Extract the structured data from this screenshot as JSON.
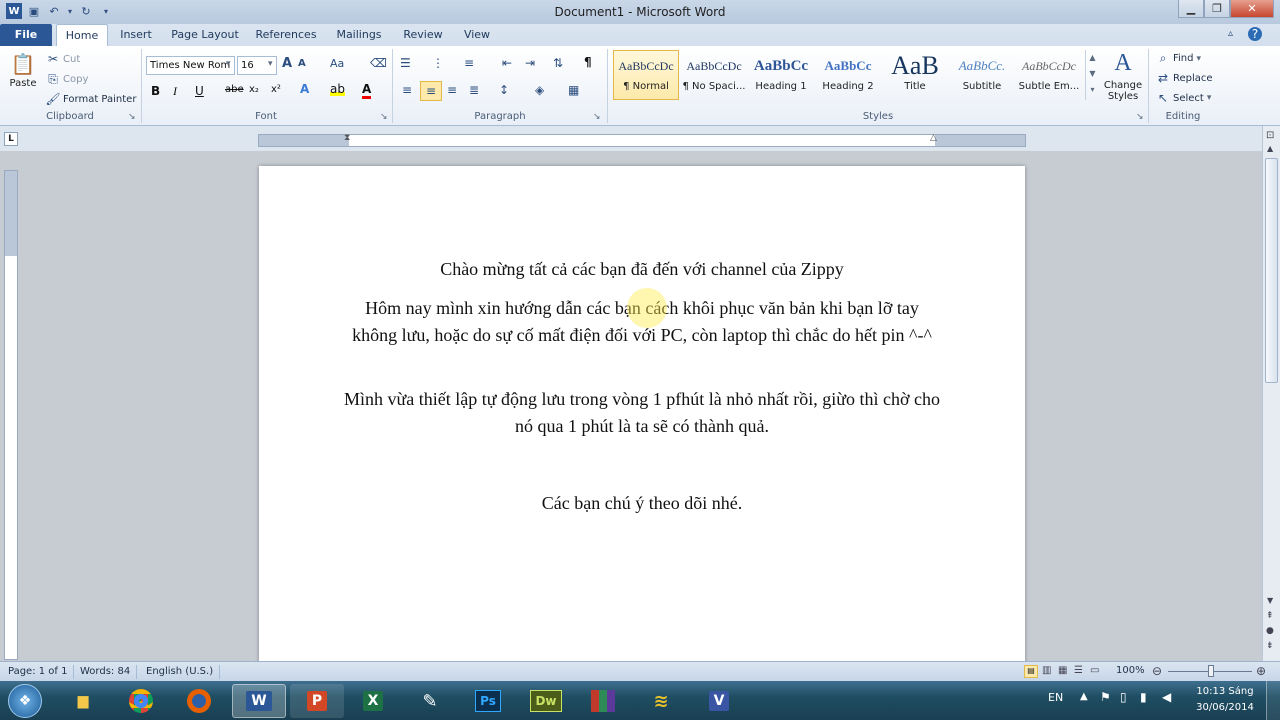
{
  "window": {
    "title": "Document1 - Microsoft Word"
  },
  "ribbon_tabs": [
    "File",
    "Home",
    "Insert",
    "Page Layout",
    "References",
    "Mailings",
    "Review",
    "View"
  ],
  "clipboard": {
    "paste": "Paste",
    "cut": "Cut",
    "copy": "Copy",
    "format_painter": "Format Painter",
    "label": "Clipboard"
  },
  "font": {
    "name": "Times New Rom",
    "size": "16",
    "label": "Font",
    "bold": "B",
    "italic": "I",
    "underline": "U",
    "strike": "abe",
    "sub": "x₂",
    "sup": "x²",
    "grow": "A",
    "change_case": "Aa"
  },
  "paragraph": {
    "label": "Paragraph",
    "pilcrow": "¶"
  },
  "styles": {
    "label": "Styles",
    "items": [
      {
        "sample": "AaBbCcDc",
        "name": "¶ Normal"
      },
      {
        "sample": "AaBbCcDc",
        "name": "¶ No Spaci..."
      },
      {
        "sample": "AaBbCc",
        "name": "Heading 1"
      },
      {
        "sample": "AaBbCc",
        "name": "Heading 2"
      },
      {
        "sample": "AaB",
        "name": "Title"
      },
      {
        "sample": "AaBbCc.",
        "name": "Subtitle"
      },
      {
        "sample": "AaBbCcDc",
        "name": "Subtle Em..."
      }
    ],
    "change_styles": "Change Styles"
  },
  "editing": {
    "label": "Editing",
    "find": "Find",
    "replace": "Replace",
    "select": "Select"
  },
  "document": {
    "paragraphs": [
      "Chào mừng tất cả các bạn đã đến với channel của Zippy",
      "Hôm nay mình xin hướng dẫn các bạn cách khôi phục văn bản khi bạn lỡ tay không lưu, hoặc do sự cố mất điện đối với PC, còn laptop thì chắc do hết pin ^-^",
      "Mình vừa thiết lập tự động lưu trong vòng 1 pfhút là nhỏ nhất rồi, giừo thì chờ cho nó qua 1 phút là ta sẽ có thành quả.",
      "Các bạn chú ý theo dõi nhé."
    ]
  },
  "status": {
    "page": "Page: 1 of 1",
    "words": "Words: 84",
    "language": "English (U.S.)",
    "zoom": "100%"
  },
  "taskbar": {
    "apps": [
      "Ps",
      "Dw"
    ],
    "lang": "EN",
    "time": "10:13 Sáng",
    "date": "30/06/2014"
  }
}
